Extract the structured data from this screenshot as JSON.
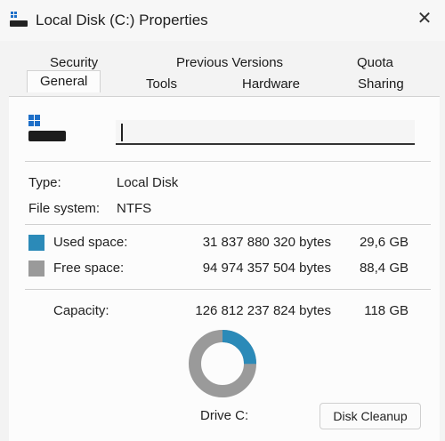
{
  "window": {
    "title": "Local Disk (C:) Properties",
    "close_glyph": "✕"
  },
  "tabs": {
    "row1": [
      {
        "label": "Security"
      },
      {
        "label": "Previous Versions"
      },
      {
        "label": "Quota"
      }
    ],
    "row2": [
      {
        "label": "General",
        "selected": true
      },
      {
        "label": "Tools"
      },
      {
        "label": "Hardware"
      },
      {
        "label": "Sharing"
      }
    ]
  },
  "general": {
    "drive_icon": "drive-icon",
    "name_value": "",
    "type_label": "Type:",
    "type_value": "Local Disk",
    "fs_label": "File system:",
    "fs_value": "NTFS",
    "used": {
      "label": "Used space:",
      "bytes": "31 837 880 320 bytes",
      "size": "29,6 GB",
      "color": "#2b8ab8"
    },
    "free": {
      "label": "Free space:",
      "bytes": "94 974 357 504 bytes",
      "size": "88,4 GB",
      "color": "#9a9a9a"
    },
    "capacity": {
      "label": "Capacity:",
      "bytes": "126 812 237 824 bytes",
      "size": "118 GB"
    },
    "used_fraction": 0.251,
    "drive_label": "Drive C:",
    "cleanup_label": "Disk Cleanup"
  }
}
